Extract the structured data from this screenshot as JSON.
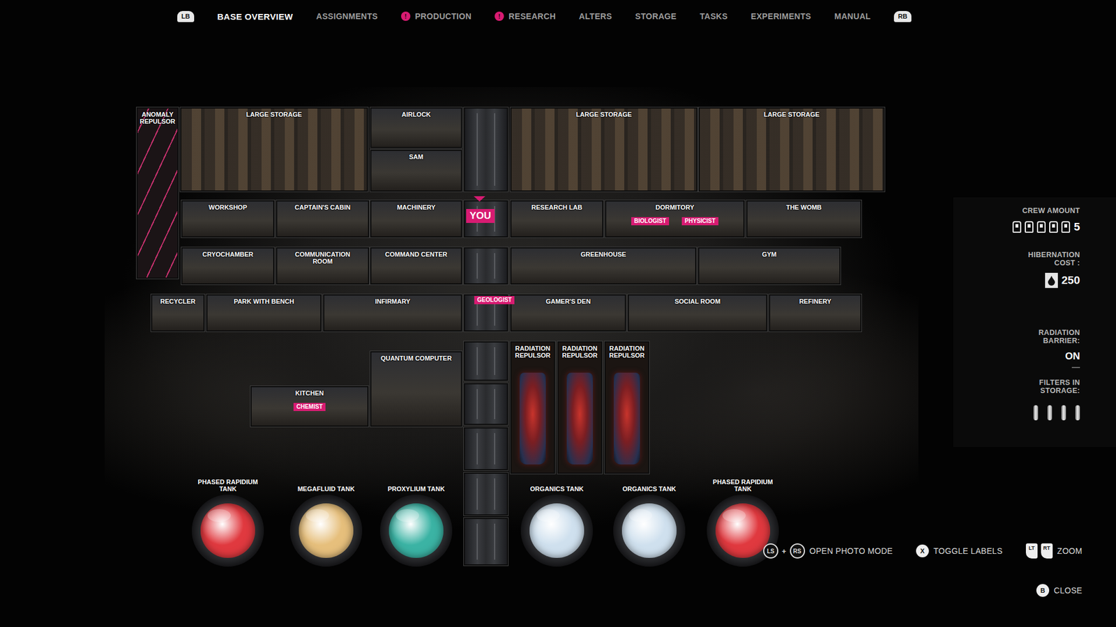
{
  "nav": {
    "left_button": "LB",
    "right_button": "RB",
    "alert_mark": "!",
    "tabs": [
      {
        "label": "BASE OVERVIEW",
        "selected": true,
        "alert": false
      },
      {
        "label": "ASSIGNMENTS",
        "selected": false,
        "alert": false
      },
      {
        "label": "PRODUCTION",
        "selected": false,
        "alert": true
      },
      {
        "label": "RESEARCH",
        "selected": false,
        "alert": true
      },
      {
        "label": "ALTERS",
        "selected": false,
        "alert": false
      },
      {
        "label": "STORAGE",
        "selected": false,
        "alert": false
      },
      {
        "label": "TASKS",
        "selected": false,
        "alert": false
      },
      {
        "label": "EXPERIMENTS",
        "selected": false,
        "alert": false
      },
      {
        "label": "MANUAL",
        "selected": false,
        "alert": false
      }
    ]
  },
  "base": {
    "rooms": [
      {
        "name": "ANOMALY REPULSOR",
        "kind": "anomaly",
        "badges": []
      },
      {
        "name": "LARGE STORAGE",
        "kind": "storage",
        "badges": []
      },
      {
        "name": "AIRLOCK",
        "kind": "room",
        "badges": []
      },
      {
        "name": "SAM",
        "kind": "room",
        "badges": []
      },
      {
        "name": "LARGE STORAGE",
        "kind": "storage",
        "badges": []
      },
      {
        "name": "LARGE STORAGE",
        "kind": "storage",
        "badges": []
      },
      {
        "name": "WORKSHOP",
        "kind": "room",
        "badges": []
      },
      {
        "name": "CAPTAIN'S CABIN",
        "kind": "room",
        "badges": []
      },
      {
        "name": "MACHINERY",
        "kind": "room",
        "badges": []
      },
      {
        "name": "RESEARCH LAB",
        "kind": "room",
        "badges": []
      },
      {
        "name": "DORMITORY",
        "kind": "room",
        "badges": [
          "BIOLOGIST",
          "PHYSICIST"
        ]
      },
      {
        "name": "THE WOMB",
        "kind": "room",
        "badges": []
      },
      {
        "name": "CRYOCHAMBER",
        "kind": "room",
        "badges": []
      },
      {
        "name": "COMMUNICATION ROOM",
        "kind": "room",
        "badges": []
      },
      {
        "name": "COMMAND CENTER",
        "kind": "room",
        "badges": []
      },
      {
        "name": "GREENHOUSE",
        "kind": "room",
        "badges": []
      },
      {
        "name": "GYM",
        "kind": "room",
        "badges": []
      },
      {
        "name": "RECYCLER",
        "kind": "room",
        "badges": []
      },
      {
        "name": "PARK WITH BENCH",
        "kind": "room",
        "badges": []
      },
      {
        "name": "INFIRMARY",
        "kind": "room",
        "badges": []
      },
      {
        "name": "GAMER'S DEN",
        "kind": "room",
        "badges": []
      },
      {
        "name": "SOCIAL ROOM",
        "kind": "room",
        "badges": []
      },
      {
        "name": "REFINERY",
        "kind": "room",
        "badges": []
      },
      {
        "name": "QUANTUM COMPUTER",
        "kind": "room",
        "badges": []
      },
      {
        "name": "KITCHEN",
        "kind": "room",
        "badges": [
          "CHEMIST"
        ]
      },
      {
        "name": "RADIATION REPULSOR",
        "kind": "repulsor",
        "badges": []
      },
      {
        "name": "RADIATION REPULSOR",
        "kind": "repulsor",
        "badges": []
      },
      {
        "name": "RADIATION REPULSOR",
        "kind": "repulsor",
        "badges": []
      }
    ],
    "elevator_badges": [
      {
        "label": "YOU",
        "kind": "player"
      },
      {
        "label": "GEOLOGIST",
        "kind": "crew"
      }
    ],
    "tanks": [
      {
        "name": "PHASED RAPIDIUM TANK",
        "color": "#e0393f"
      },
      {
        "name": "MEGAFLUID TANK",
        "color": "#e6bf7c"
      },
      {
        "name": "PROXYLIUM TANK",
        "color": "#3bb3a4"
      },
      {
        "name": "ORGANICS TANK",
        "color": "#cfe0ee"
      },
      {
        "name": "ORGANICS TANK",
        "color": "#cfe0ee"
      },
      {
        "name": "PHASED RAPIDIUM TANK",
        "color": "#e0393f"
      }
    ]
  },
  "stats": {
    "crew": {
      "label": "CREW AMOUNT",
      "icons": 5,
      "count": "5"
    },
    "hibernation": {
      "label": "HIBERNATION COST :",
      "value": "250"
    },
    "radiation": {
      "label": "RADIATION BARRIER:",
      "value": "ON"
    },
    "filters": {
      "label": "FILTERS IN STORAGE:",
      "icons": 4
    }
  },
  "hints": [
    {
      "keys": [
        {
          "label": "LS",
          "kind": "stick"
        },
        {
          "label": "+",
          "kind": "plus"
        },
        {
          "label": "RS",
          "kind": "stick"
        }
      ],
      "label": "OPEN PHOTO MODE"
    },
    {
      "keys": [
        {
          "label": "X",
          "kind": "face"
        }
      ],
      "label": "TOGGLE LABELS"
    },
    {
      "keys": [
        {
          "label": "LT",
          "kind": "trigger"
        },
        {
          "label": "RT",
          "kind": "trigger"
        }
      ],
      "label": "ZOOM"
    },
    {
      "keys": [
        {
          "label": "B",
          "kind": "face"
        }
      ],
      "label": "CLOSE"
    }
  ]
}
